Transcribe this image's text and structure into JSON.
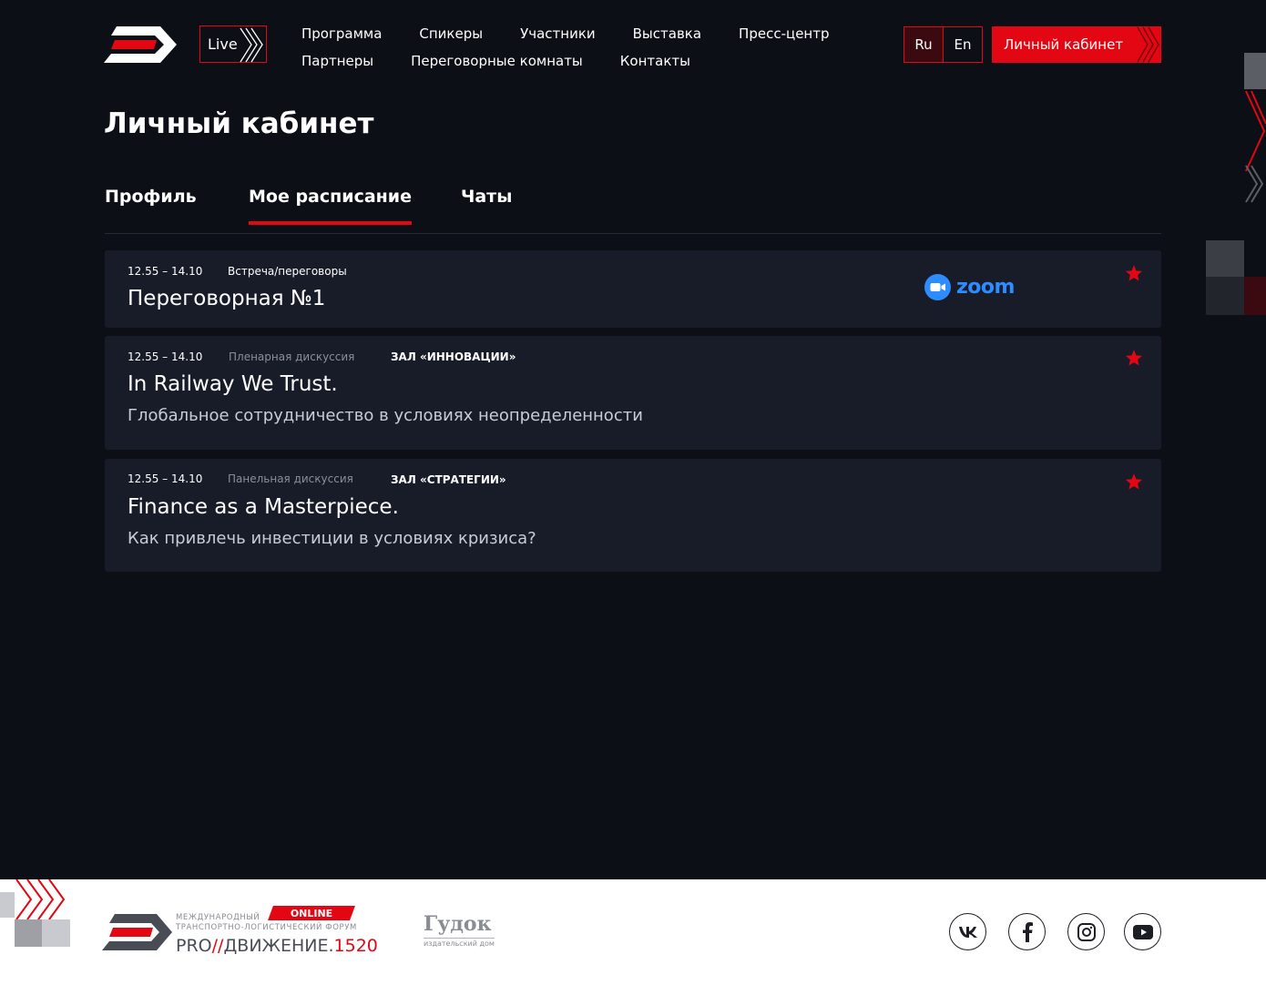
{
  "header": {
    "live_label": "Live",
    "nav_row1": [
      "Программа",
      "Спикеры",
      "Участники",
      "Выставка",
      "Пресс-центр"
    ],
    "nav_row2": [
      "Партнеры",
      "Переговорные комнаты",
      "Контакты"
    ],
    "lang_ru": "Ru",
    "lang_en": "En",
    "cabinet_label": "Личный кабинет"
  },
  "page": {
    "title": "Личный кабинет",
    "tabs": [
      "Профиль",
      "Мое расписание",
      "Чаты"
    ],
    "active_tab": "Мое расписание"
  },
  "schedule": [
    {
      "time": "12.55 – 14.10",
      "kind": "Встреча/переговоры",
      "hall": "",
      "title": "Переговорная №1",
      "subtitle": "",
      "platform": "zoom"
    },
    {
      "time": "12.55 – 14.10",
      "kind": "Пленарная дискуссия",
      "hall": "ЗАЛ «ИННОВАЦИИ»",
      "title": "In Railway We Trust.",
      "subtitle": "Глобальное сотрудничество в условиях неопределенности"
    },
    {
      "time": "12.55 – 14.10",
      "kind": "Панельная дискуссия",
      "hall": "ЗАЛ «СТРАТЕГИИ»",
      "title": "Finance as a Masterpiece.",
      "subtitle": "Как привлечь инвестиции в условиях кризиса?"
    }
  ],
  "footer": {
    "forum_line1": "Международный",
    "forum_line2": "транспортно-логистический форум",
    "online": "ONLINE",
    "brand_pro": "PRO",
    "brand_slashes": "//",
    "brand_dvizh": "ДВИЖЕНИЕ.",
    "brand_num": "1520",
    "gudok": "Гудок",
    "gudok_sub": "издательский дом",
    "social": [
      "vk-icon",
      "facebook-icon",
      "instagram-icon",
      "youtube-icon"
    ]
  },
  "colors": {
    "background": "#0d0f17",
    "card": "#181c28",
    "accent": "#e30613",
    "zoom": "#2d8cff"
  }
}
